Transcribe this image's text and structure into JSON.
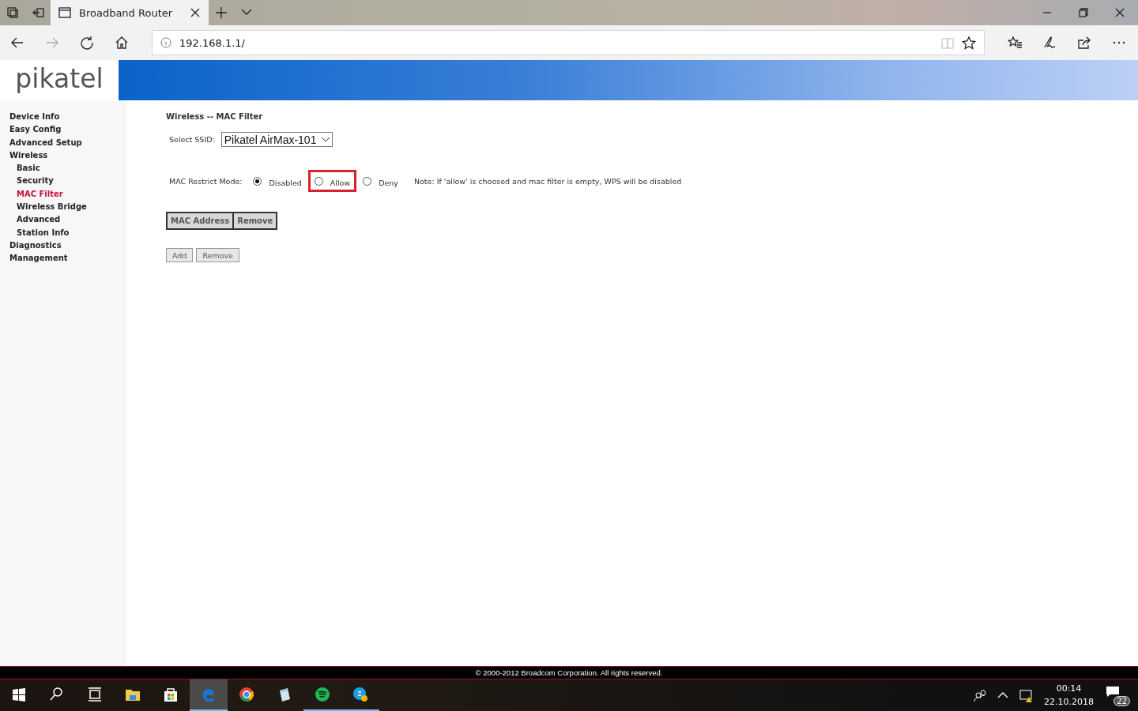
{
  "browser": {
    "tab_title": "Broadband Router",
    "address": "192.168.1.1/"
  },
  "logo": "pikatel",
  "sidebar": {
    "items": [
      {
        "label": "Device Info",
        "selected": false
      },
      {
        "label": "Easy Config",
        "selected": false
      },
      {
        "label": "Advanced Setup",
        "selected": false
      },
      {
        "label": "Wireless",
        "selected": false,
        "children": [
          {
            "label": "Basic",
            "selected": false
          },
          {
            "label": "Security",
            "selected": false
          },
          {
            "label": "MAC Filter",
            "selected": true
          },
          {
            "label": "Wireless Bridge",
            "selected": false
          },
          {
            "label": "Advanced",
            "selected": false
          },
          {
            "label": "Station Info",
            "selected": false
          }
        ]
      },
      {
        "label": "Diagnostics",
        "selected": false
      },
      {
        "label": "Management",
        "selected": false
      }
    ]
  },
  "page": {
    "title": "Wireless -- MAC Filter",
    "ssid_label": "Select SSID:",
    "ssid_value": "Pikatel AirMax-101",
    "mode_label": "MAC Restrict Mode:",
    "modes": [
      {
        "label": "Disabled",
        "selected": true,
        "highlighted": false
      },
      {
        "label": "Allow",
        "selected": false,
        "highlighted": true
      },
      {
        "label": "Deny",
        "selected": false,
        "highlighted": false
      }
    ],
    "note": "Note: If 'allow' is choosed and mac filter is empty, WPS will be disabled",
    "table": {
      "columns": [
        "MAC Address",
        "Remove"
      ]
    },
    "buttons": [
      "Add",
      "Remove"
    ]
  },
  "footer": "© 2000-2012 Broadcom Corporation. All rights reserved.",
  "taskbar": {
    "apps": [
      {
        "kind": "start",
        "running": false,
        "active": false
      },
      {
        "kind": "search",
        "running": false,
        "active": false
      },
      {
        "kind": "taskview",
        "running": false,
        "active": false
      },
      {
        "kind": "folder",
        "running": false,
        "active": false
      },
      {
        "kind": "store",
        "running": false,
        "active": false
      },
      {
        "kind": "edge",
        "running": true,
        "active": true
      },
      {
        "kind": "chrome",
        "running": false,
        "active": false
      },
      {
        "kind": "notepad",
        "running": false,
        "active": false
      },
      {
        "kind": "spotify",
        "running": true,
        "active": false
      },
      {
        "kind": "skype",
        "running": true,
        "active": false
      }
    ],
    "time": "00:14",
    "date": "22.10.2018",
    "notifications": "22"
  }
}
